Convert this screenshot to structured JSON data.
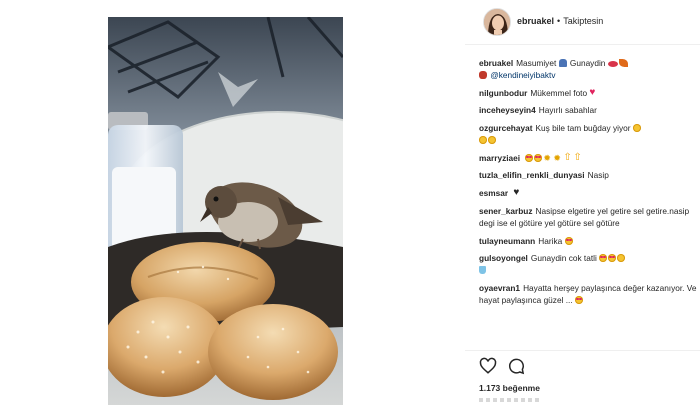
{
  "post": {
    "header": {
      "username": "ebruakel",
      "separator": "•",
      "follow_status": "Takiptesin",
      "avatar_icon": "profile-avatar"
    },
    "caption": {
      "username": "ebruakel",
      "text": "Masumiyet",
      "text2": "Gunaydin",
      "mention": "@kendineiyibaktv"
    },
    "comments": [
      {
        "user": "nilgunbodur",
        "text": "Mükemmel foto"
      },
      {
        "user": "inceheyseyin4",
        "text": "Hayırlı sabahlar"
      },
      {
        "user": "ozgurcehayat",
        "text": "Kuş bile tam buğday yiyor"
      },
      {
        "user": "marryziaei",
        "text": ""
      },
      {
        "user": "tuzla_elifin_renkli_dunyasi",
        "text": "Nasip"
      },
      {
        "user": "esmsar",
        "text": ""
      },
      {
        "user": "sener_karbuz",
        "text": "Nasipse elgetire yel getire sel getire.nasip degi ise el götüre yel götüre sel götüre"
      },
      {
        "user": "tulayneumann",
        "text": "Harika"
      },
      {
        "user": "gulsoyongel",
        "text": "Gunaydin cok tatli"
      },
      {
        "user": "oyaevran1",
        "text": "Hayatta herşey paylaşınca değer kazanıyor. Ve hayat paylaşınca güzel ..."
      }
    ],
    "actions": {
      "like_icon": "heart-outline-icon",
      "comment_icon": "comment-bubble-icon"
    },
    "likes_label": "1.173 beğenme"
  }
}
